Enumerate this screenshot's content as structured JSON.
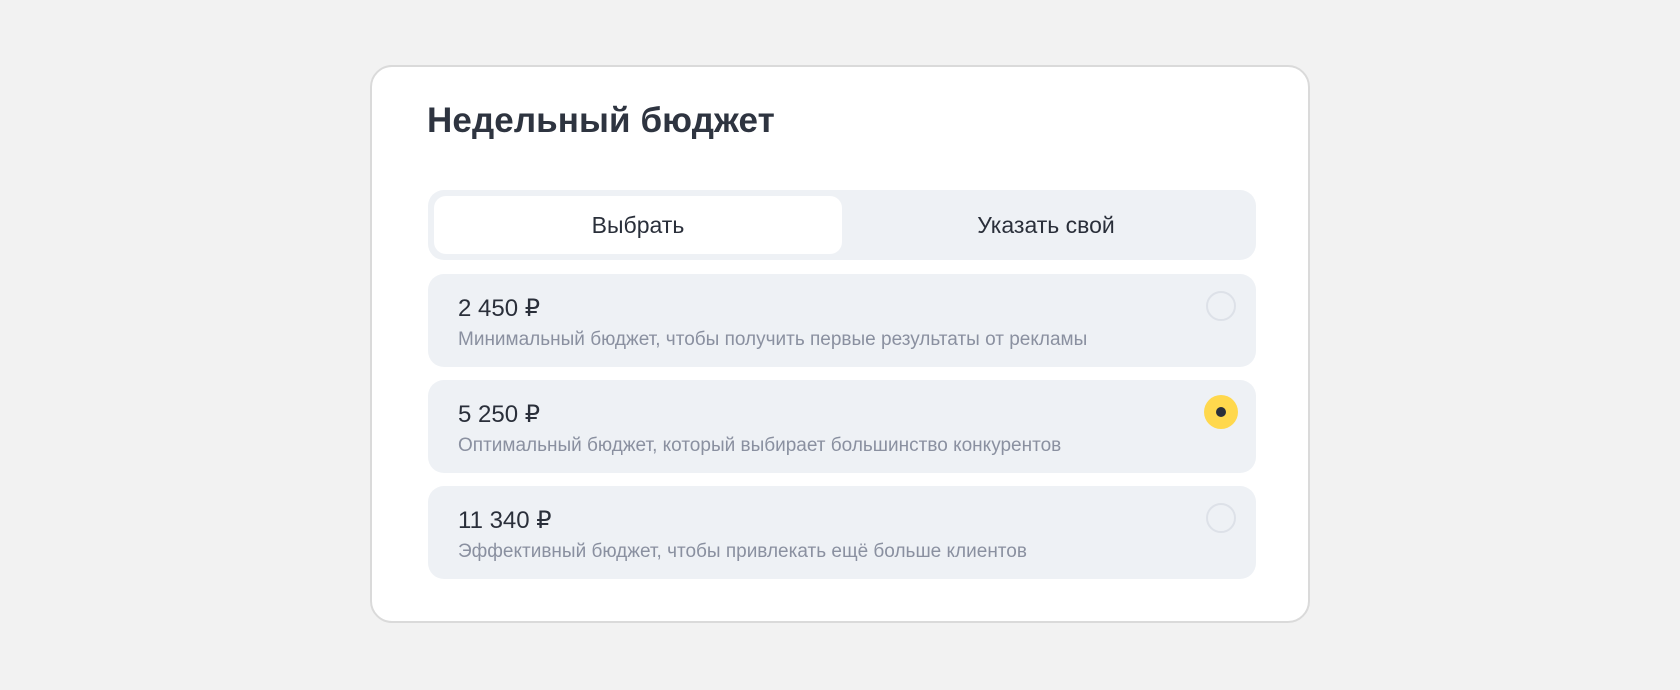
{
  "budget": {
    "title": "Недельный бюджет",
    "tabs": [
      {
        "label": "Выбрать",
        "active": true
      },
      {
        "label": "Указать свой",
        "active": false
      }
    ],
    "options": [
      {
        "price": "2 450 ₽",
        "description": "Минимальный бюджет, чтобы получить первые результаты от рекламы",
        "selected": false
      },
      {
        "price": "5 250 ₽",
        "description": "Оптимальный бюджет, который выбирает большинство конкурентов",
        "selected": true
      },
      {
        "price": "11 340 ₽",
        "description": "Эффективный бюджет, чтобы привлекать ещё больше клиентов",
        "selected": false
      }
    ]
  },
  "colors": {
    "background": "#f2f2f2",
    "card": "#ffffff",
    "option_bg": "#eef1f5",
    "accent_yellow": "#ffd84d",
    "text_primary": "#2a2f3a",
    "text_secondary": "#8a90a0"
  }
}
